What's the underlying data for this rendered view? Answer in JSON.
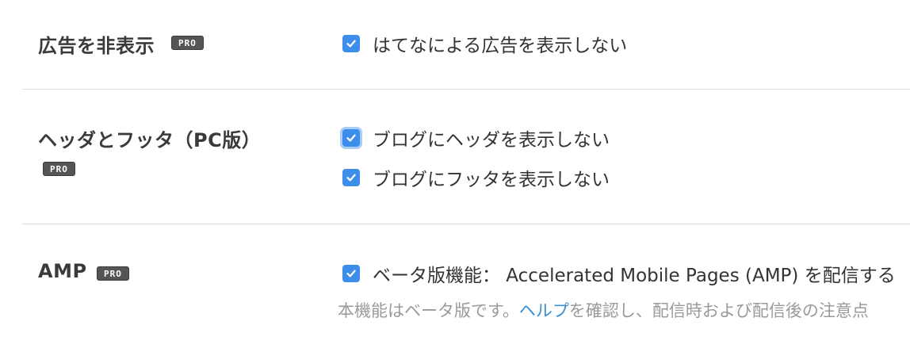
{
  "sections": {
    "hide_ads": {
      "title": "広告を非表示",
      "badge": "PRO",
      "options": [
        {
          "label": "はてなによる広告を表示しない",
          "checked": true
        }
      ]
    },
    "header_footer": {
      "title": "ヘッダとフッタ（PC版）",
      "badge": "PRO",
      "options": [
        {
          "label": "ブログにヘッダを表示しない",
          "checked": true,
          "focused": true
        },
        {
          "label": "ブログにフッタを表示しない",
          "checked": true
        }
      ]
    },
    "amp": {
      "title": "AMP",
      "badge": "PRO",
      "options": [
        {
          "label": "ベータ版機能： Accelerated Mobile Pages (AMP) を配信する",
          "checked": true
        }
      ],
      "note": {
        "prefix": "本機能はベータ版です。",
        "link": "ヘルプ",
        "suffix": "を確認し、配信時および配信後の注意点"
      }
    }
  },
  "colors": {
    "checkbox": "#3d8eea",
    "focus_ring": "#a8cdf7",
    "link": "#3a8fd0",
    "divider": "#dddddd",
    "badge": "#555555"
  },
  "icons": {
    "checkmark": "check-icon"
  }
}
